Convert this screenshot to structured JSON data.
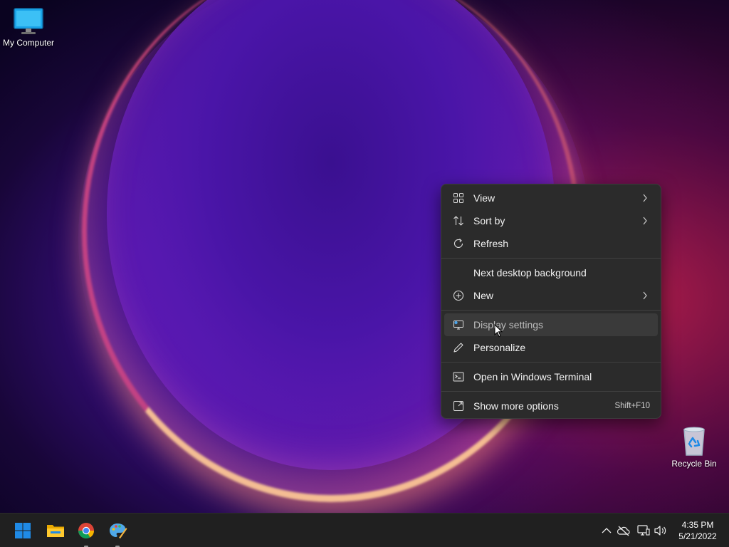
{
  "desktop": {
    "icons": [
      {
        "label": "My Computer",
        "icon": "monitor-icon"
      },
      {
        "label": "Recycle Bin",
        "icon": "recycle-bin-icon"
      }
    ]
  },
  "context_menu": {
    "items": [
      {
        "label": "View",
        "icon": "grid-view-icon",
        "submenu": true
      },
      {
        "label": "Sort by",
        "icon": "sort-arrows-icon",
        "submenu": true
      },
      {
        "label": "Refresh",
        "icon": "refresh-icon",
        "submenu": false
      },
      {
        "label": "Next desktop background",
        "icon": "",
        "submenu": false
      },
      {
        "label": "New",
        "icon": "plus-circle-icon",
        "submenu": true
      },
      {
        "label": "Display settings",
        "icon": "display-settings-icon",
        "submenu": false,
        "highlighted": true
      },
      {
        "label": "Personalize",
        "icon": "pen-icon",
        "submenu": false
      },
      {
        "label": "Open in Windows Terminal",
        "icon": "terminal-icon",
        "submenu": false
      },
      {
        "label": "Show more options",
        "icon": "more-options-icon",
        "submenu": false,
        "shortcut": "Shift+F10"
      }
    ]
  },
  "taskbar": {
    "apps": [
      {
        "name": "Start",
        "icon": "windows-start-icon",
        "running": false
      },
      {
        "name": "File Explorer",
        "icon": "folder-icon",
        "running": false
      },
      {
        "name": "Google Chrome",
        "icon": "chrome-icon",
        "running": true
      },
      {
        "name": "Paint",
        "icon": "paint-palette-icon",
        "running": true
      }
    ],
    "tray": [
      "chevron-up-icon",
      "onedrive-offline-icon",
      "network-icon",
      "volume-icon"
    ],
    "clock": {
      "time": "4:35 PM",
      "date": "5/21/2022"
    }
  },
  "colors": {
    "menu_bg": "#2b2b2b",
    "menu_hover": "#3a3a3a",
    "taskbar_bg": "#202020",
    "accent_blue": "#1f8ae6"
  }
}
